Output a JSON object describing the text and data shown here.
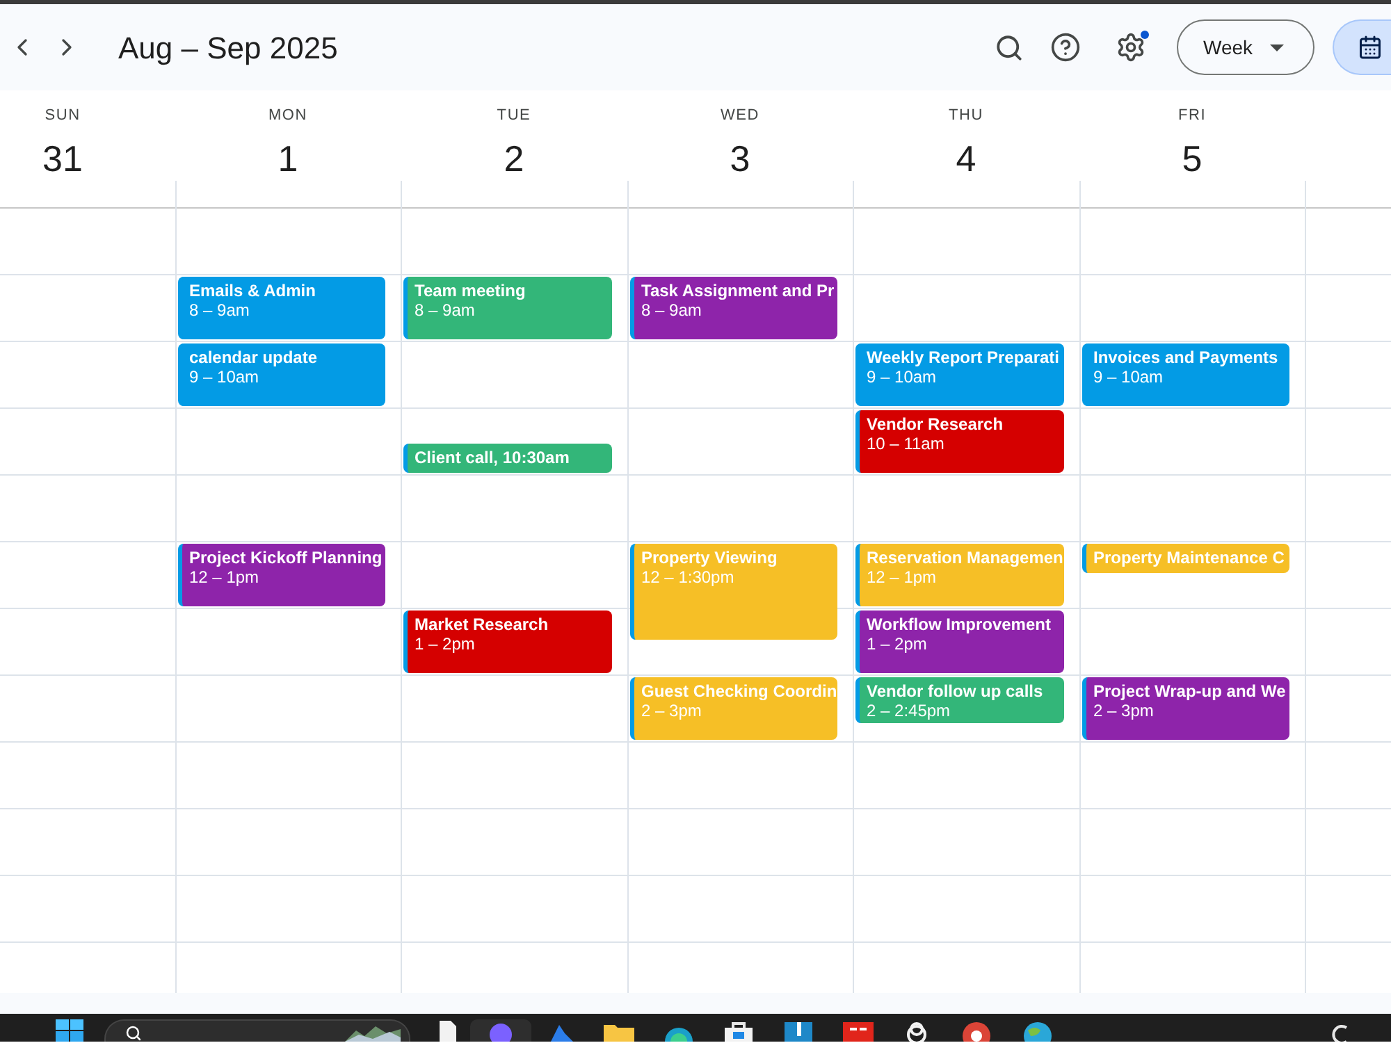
{
  "toolbar": {
    "title": "Aug – Sep 2025",
    "view_select": {
      "label": "Week"
    }
  },
  "days": [
    {
      "weekday": "SUN",
      "date": "31"
    },
    {
      "weekday": "MON",
      "date": "1",
      "slots": {
        "08:00": [
          {
            "kind": "full",
            "title": "Emails & Admin",
            "time": "8 – 9am",
            "color": "#039be5"
          }
        ],
        "09:00": [
          {
            "kind": "full",
            "title": "calendar update",
            "time": "9 – 10am",
            "color": "#039be5"
          }
        ],
        "12:00": [
          {
            "kind": "full",
            "title": "Project Kickoff Planning",
            "time": "12 – 1pm",
            "color": "#8e24aa"
          }
        ]
      }
    },
    {
      "weekday": "TUE",
      "date": "2",
      "slots": {
        "08:00": [
          {
            "kind": "full",
            "title": "Team meeting",
            "time": "8 – 9am",
            "color": "#33b679"
          }
        ],
        "10:30": [
          {
            "kind": "compact",
            "title": "Client call, 10:30am",
            "color": "#33b679"
          }
        ],
        "13:00": [
          {
            "kind": "full",
            "title": "Market Research",
            "time": "1 – 2pm",
            "color": "#d50000"
          }
        ]
      }
    },
    {
      "weekday": "WED",
      "date": "3",
      "slots": {
        "08:00": [
          {
            "kind": "full",
            "title": "Task Assignment and Pr",
            "time": "8 – 9am",
            "color": "#8e24aa"
          }
        ],
        "12:00": [
          {
            "kind": "full",
            "title": "Property Viewing",
            "time": "12 – 1:30pm",
            "color": "#f6bf26"
          }
        ],
        "14:00": [
          {
            "kind": "full",
            "title": "Guest Checking Coordin",
            "time": "2 – 3pm",
            "color": "#f6bf26"
          }
        ]
      }
    },
    {
      "weekday": "THU",
      "date": "4",
      "slots": {
        "09:00": [
          {
            "kind": "full",
            "title": "Weekly Report Preparati",
            "time": "9 – 10am",
            "color": "#039be5"
          }
        ],
        "10:00": [
          {
            "kind": "full",
            "title": "Vendor Research",
            "time": "10 – 11am",
            "color": "#d50000"
          }
        ],
        "12:00": [
          {
            "kind": "full",
            "title": "Reservation Managemen",
            "time": "12 – 1pm",
            "color": "#f6bf26"
          }
        ],
        "13:00": [
          {
            "kind": "full",
            "title": "Workflow Improvement",
            "time": "1 – 2pm",
            "color": "#8e24aa"
          }
        ],
        "14:00": [
          {
            "kind": "full",
            "title": "Vendor follow up calls",
            "time": "2 – 2:45pm",
            "color": "#33b679"
          }
        ]
      }
    },
    {
      "weekday": "FRI",
      "date": "5",
      "slots": {
        "09:00": [
          {
            "kind": "full",
            "title": "Invoices and Payments",
            "time": "9 – 10am",
            "color": "#039be5"
          }
        ],
        "12:00": [
          {
            "kind": "compact",
            "title": "Property Maintenance C",
            "color": "#f6bf26"
          }
        ],
        "14:00": [
          {
            "kind": "full",
            "title": "Project Wrap-up and We",
            "time": "2 – 3pm",
            "color": "#8e24aa"
          }
        ]
      }
    }
  ]
}
